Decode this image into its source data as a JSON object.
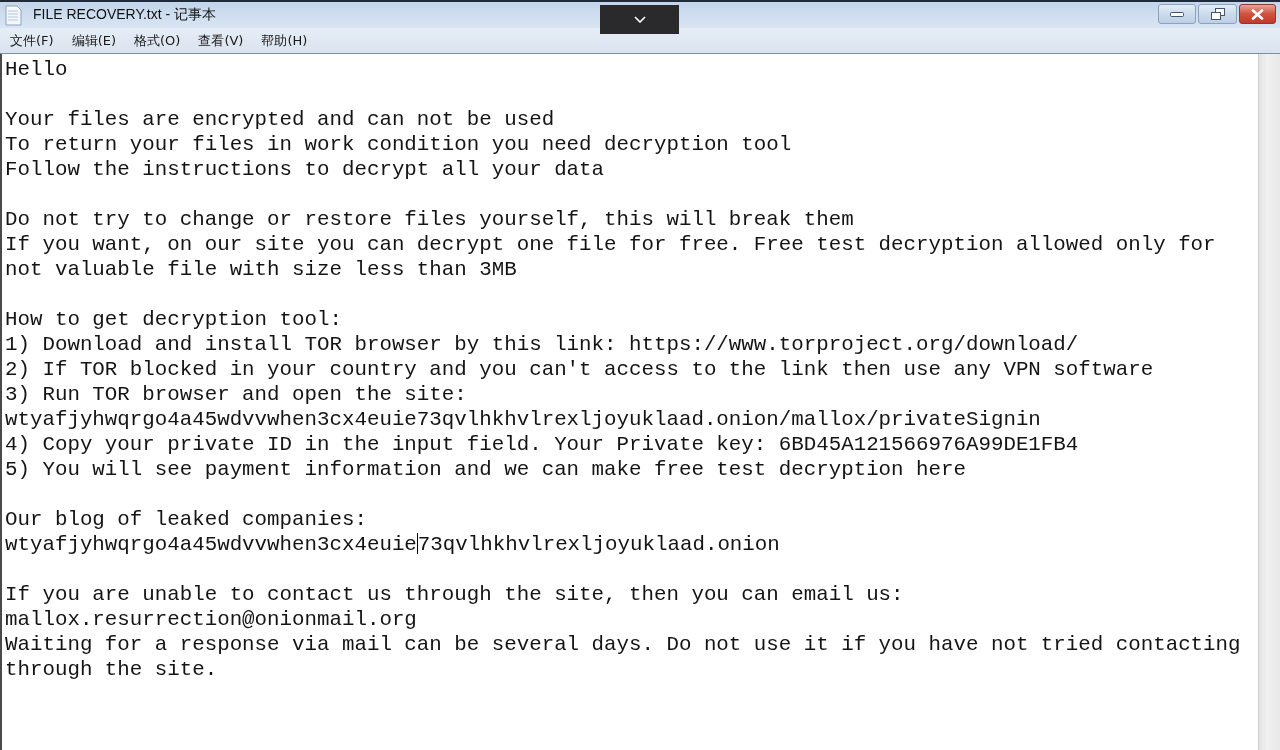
{
  "window": {
    "title": "FILE RECOVERY.txt - 记事本"
  },
  "menu": [
    "文件(F)",
    "编辑(E)",
    "格式(O)",
    "查看(V)",
    "帮助(H)"
  ],
  "document": {
    "paragraphs": [
      [
        {
          "kind": "text",
          "text": "Hello"
        }
      ],
      [
        {
          "kind": "text",
          "text": "Your files are encrypted and can not be used"
        },
        {
          "kind": "text",
          "text": "To return your files in work condition you need decryption tool"
        },
        {
          "kind": "text",
          "text": "Follow the instructions to decrypt all your data"
        }
      ],
      [
        {
          "kind": "text",
          "text": "Do not try to change or restore files yourself, this will break them"
        },
        {
          "kind": "text",
          "text": "If you want, on our site you can decrypt one file for free. Free test decryption allowed only for"
        },
        {
          "kind": "text",
          "text": "not valuable file with size less than 3MB"
        }
      ],
      [
        {
          "kind": "text",
          "text": "How to get decryption tool:"
        },
        {
          "kind": "text",
          "text": "1) Download and install TOR browser by this link: https://www.torproject.org/download/"
        },
        {
          "kind": "text",
          "text": "2) If TOR blocked in your country and you can't access to the link then use any VPN software"
        },
        {
          "kind": "text",
          "text": "3) Run TOR browser and open the site:"
        },
        {
          "kind": "text",
          "text": "wtyafjyhwqrgo4a45wdvvwhen3cx4euie73qvlhkhvlrexljoyuklaad.onion/mallox/privateSignin"
        },
        {
          "kind": "text",
          "text": "4) Copy your private ID in the input field. Your Private key: 6BD45A121566976A99DE1FB4"
        },
        {
          "kind": "text",
          "text": "5) You will see payment information and we can make free test decryption here"
        }
      ],
      [
        {
          "kind": "text",
          "text": "Our blog of leaked companies:"
        },
        {
          "kind": "caret",
          "before": "wtyafjyhwqrgo4a45wdvvwhen3cx4euie",
          "after": "73qvlhkhvlrexljoyuklaad.onion"
        }
      ],
      [
        {
          "kind": "text",
          "text": "If you are unable to contact us through the site, then you can email us:"
        },
        {
          "kind": "text",
          "text": "mallox.resurrection@onionmail.org"
        },
        {
          "kind": "text",
          "text": "Waiting for a response via mail can be several days. Do not use it if you have not tried contacting"
        },
        {
          "kind": "text",
          "text": "through the site."
        }
      ]
    ]
  }
}
